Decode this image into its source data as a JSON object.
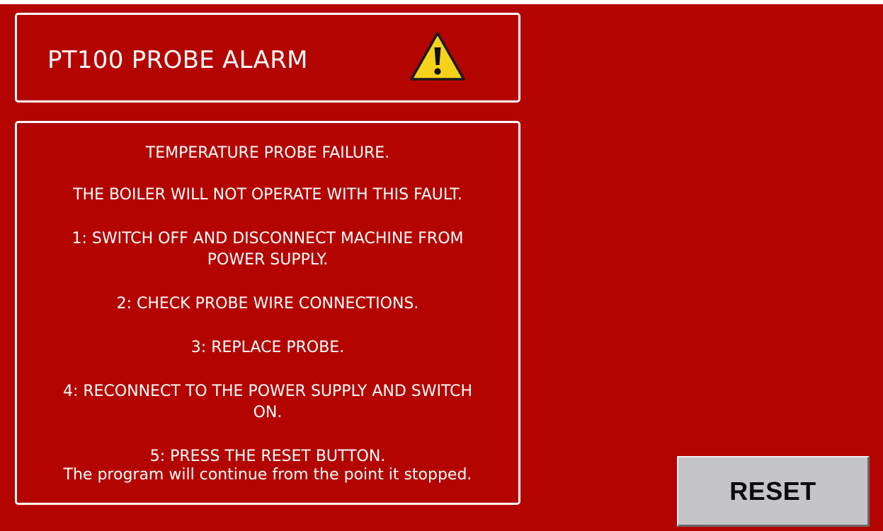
{
  "header": {
    "title": "PT100 PROBE ALARM",
    "icon": "warning-icon",
    "icon_color": "#f7d21a"
  },
  "message": {
    "lines": [
      "TEMPERATURE PROBE FAILURE.",
      "THE BOILER WILL NOT OPERATE WITH THIS FAULT.",
      "1: SWITCH OFF AND DISCONNECT MACHINE FROM",
      "POWER SUPPLY.",
      "2: CHECK PROBE WIRE CONNECTIONS.",
      "3: REPLACE PROBE.",
      "4: RECONNECT TO THE POWER SUPPLY AND SWITCH",
      "ON.",
      "5: PRESS THE RESET BUTTON.",
      "The program will continue from the point it stopped."
    ]
  },
  "reset_button": {
    "label": "RESET"
  },
  "colors": {
    "background": "#b40400",
    "panel_border": "#ffffff",
    "text": "#ffffff",
    "button_face": "#c5c5c9"
  }
}
